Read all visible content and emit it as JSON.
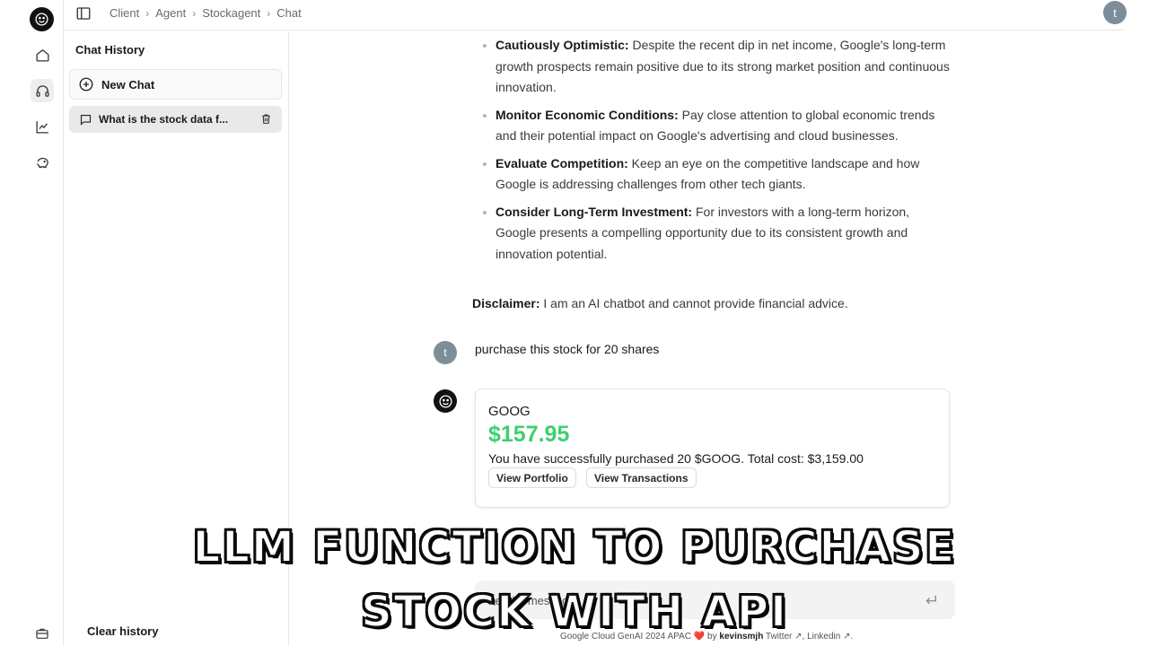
{
  "header": {
    "breadcrumbs": [
      "Client",
      "Agent",
      "Stockagent",
      "Chat"
    ],
    "user_initial": "t"
  },
  "rail": {
    "icons": [
      "smiley-logo-icon",
      "home-icon",
      "headset-icon",
      "chart-line-icon",
      "piggy-bank-icon",
      "briefcase-icon"
    ],
    "active": "headset-icon"
  },
  "sidebar": {
    "title": "Chat History",
    "new_chat_label": "New Chat",
    "chat_items": [
      {
        "label": "What is the stock data f..."
      }
    ],
    "clear_history_label": "Clear history"
  },
  "conversation": {
    "bullets": [
      {
        "title": "Cautiously Optimistic:",
        "text": " Despite the recent dip in net income, Google's long-term growth prospects remain positive due to its strong market position and continuous innovation."
      },
      {
        "title": "Monitor Economic Conditions:",
        "text": " Pay close attention to global economic trends and their potential impact on Google's advertising and cloud businesses."
      },
      {
        "title": "Evaluate Competition:",
        "text": " Keep an eye on the competitive landscape and how Google is addressing challenges from other tech giants."
      },
      {
        "title": "Consider Long-Term Investment:",
        "text": " For investors with a long-term horizon, Google presents a compelling opportunity due to its consistent growth and innovation potential."
      }
    ],
    "disclaimer_title": "Disclaimer:",
    "disclaimer_text": " I am an AI chatbot and cannot provide financial advice.",
    "user_initial": "t",
    "user_message": "purchase this stock for 20 shares",
    "stock_card": {
      "ticker": "GOOG",
      "price": "$157.95",
      "result": "You have successfully purchased 20 $GOOG. Total cost: $3,159.00",
      "view_portfolio_label": "View Portfolio",
      "view_transactions_label": "View Transactions",
      "price_color": "#3ecf6e"
    }
  },
  "composer": {
    "placeholder": "Send a message."
  },
  "footer": {
    "prefix": "Google Cloud GenAI 2024 APAC",
    "heart": "❤️",
    "by": " by ",
    "author": "kevinsmjh",
    "twitter": " Twitter ↗",
    "sep": ", ",
    "linkedin": "Linkedin ↗",
    "end": "."
  },
  "overlay": {
    "line1": "LLM FUNCTION TO PURCHASE",
    "line2": "STOCK WITH API"
  }
}
